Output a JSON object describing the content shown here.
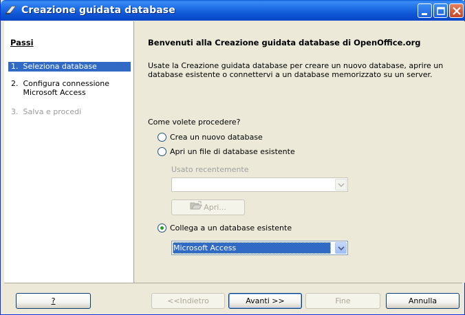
{
  "window": {
    "title": "Creazione guidata database"
  },
  "steps": {
    "title": "Passi",
    "items": [
      {
        "label": "1.  Seleziona database"
      },
      {
        "label": "2.  Configura connessione\n     Microsoft Access"
      },
      {
        "label": "3.  Salva e procedi"
      }
    ]
  },
  "main": {
    "heading": "Benvenuti alla Creazione guidata database di OpenOffice.org",
    "intro": "Usate la Creazione guidata database per creare un nuovo database, aprire un database esistente o connettervi a un database memorizzato su un server.",
    "question": "Come volete procedere?",
    "options": [
      {
        "label": "Crea un nuovo database",
        "checked": false
      },
      {
        "label": "Apri un file di database esistente",
        "checked": false
      },
      {
        "label": "Collega a un database esistente",
        "checked": true
      }
    ],
    "recent_label": "Usato recentemente",
    "recent_value": "",
    "open_button": "Apri...",
    "connection_type": "Microsoft Access"
  },
  "buttons": {
    "help": "?",
    "back": "<<Indietro",
    "next": "Avanti >>",
    "finish": "Fine",
    "cancel": "Annulla"
  },
  "colors": {
    "titlebar": "#0a5bd6",
    "selection": "#316ac5",
    "dialog_bg": "#ece9d8",
    "disabled_text": "#aca899"
  }
}
